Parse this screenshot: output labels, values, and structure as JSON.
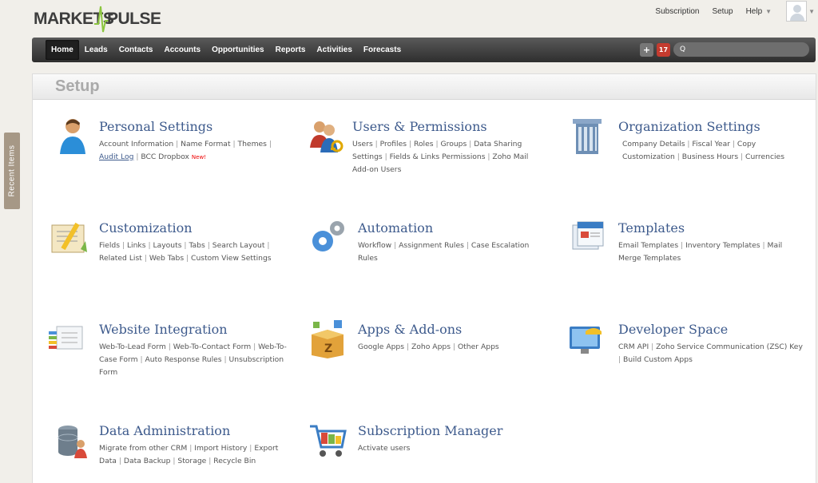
{
  "brand": {
    "left": "MARKETS",
    "right": "PULSE"
  },
  "top_links": {
    "subscription": "Subscription",
    "setup": "Setup",
    "help": "Help"
  },
  "nav": {
    "tabs": [
      "Home",
      "Leads",
      "Contacts",
      "Accounts",
      "Opportunities",
      "Reports",
      "Activities",
      "Forecasts"
    ],
    "add_label": "+",
    "calendar_label": "17",
    "search_placeholder": "Q"
  },
  "recent_items": "Recent Items",
  "page": {
    "title": "Setup"
  },
  "sections": {
    "personal": {
      "title": "Personal Settings",
      "links": [
        "Account Information",
        "Name Format",
        "Themes",
        "Audit Log",
        "BCC Dropbox"
      ],
      "new_badge": "New!"
    },
    "users": {
      "title": "Users & Permissions",
      "links": [
        "Users",
        "Profiles",
        "Roles",
        "Groups",
        "Data Sharing Settings",
        "Fields & Links Permissions",
        "Zoho Mail Add-on Users"
      ]
    },
    "org": {
      "title": "Organization Settings",
      "links": [
        "Company Details",
        "Fiscal Year",
        "Copy Customization",
        "Business Hours",
        "Currencies"
      ]
    },
    "customization": {
      "title": "Customization",
      "links": [
        "Fields",
        "Links",
        "Layouts",
        "Tabs",
        "Search Layout",
        "Related List",
        "Web Tabs",
        "Custom View Settings"
      ]
    },
    "automation": {
      "title": "Automation",
      "links": [
        "Workflow",
        "Assignment Rules",
        "Case Escalation Rules"
      ]
    },
    "templates": {
      "title": "Templates",
      "links": [
        "Email Templates",
        "Inventory Templates",
        "Mail Merge Templates"
      ]
    },
    "website": {
      "title": "Website Integration",
      "links": [
        "Web-To-Lead Form",
        "Web-To-Contact Form",
        "Web-To-Case Form",
        "Auto Response Rules",
        "Unsubscription Form"
      ]
    },
    "apps": {
      "title": "Apps & Add-ons",
      "links": [
        "Google Apps",
        "Zoho Apps",
        "Other Apps"
      ]
    },
    "developer": {
      "title": "Developer Space",
      "links": [
        "CRM API",
        "Zoho Service Communication (ZSC) Key",
        "Build Custom Apps"
      ]
    },
    "data_admin": {
      "title": "Data Administration",
      "links": [
        "Migrate from other CRM",
        "Import History",
        "Export Data",
        "Data Backup",
        "Storage",
        "Recycle Bin"
      ]
    },
    "subscription": {
      "title": "Subscription Manager",
      "links": [
        "Activate users"
      ]
    }
  }
}
